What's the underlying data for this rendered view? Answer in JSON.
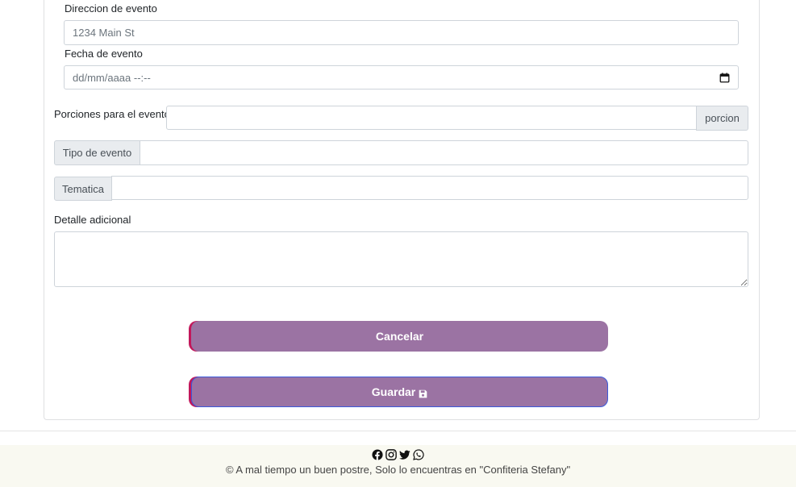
{
  "form": {
    "address": {
      "label": "Direccion de evento",
      "placeholder": "1234 Main St"
    },
    "date": {
      "label": "Fecha de evento",
      "placeholder": "dd/mm/aaaa  --:--"
    },
    "portions": {
      "label": "Porciones para el evento",
      "value": "",
      "suffix": "porcion"
    },
    "event_type": {
      "prefix": "Tipo de evento",
      "value": ""
    },
    "theme": {
      "prefix": "Tematica",
      "value": ""
    },
    "details": {
      "label": "Detalle adicional",
      "value": ""
    }
  },
  "buttons": {
    "cancel_label": "Cancelar",
    "save_label": "Guardar",
    "save_icon": "floppy-disk-icon"
  },
  "footer": {
    "icons": [
      "facebook-icon",
      "instagram-icon",
      "twitter-icon",
      "whatsapp-icon"
    ],
    "copyright": "© A mal tiempo un buen postre, Solo lo encuentras en \"Confiteria Stefany\""
  },
  "colors": {
    "button_bg": "#9b73a3",
    "button_accent": "#c2185b",
    "save_border": "#3b5bdb",
    "footer_bg": "#f9f9f1"
  }
}
